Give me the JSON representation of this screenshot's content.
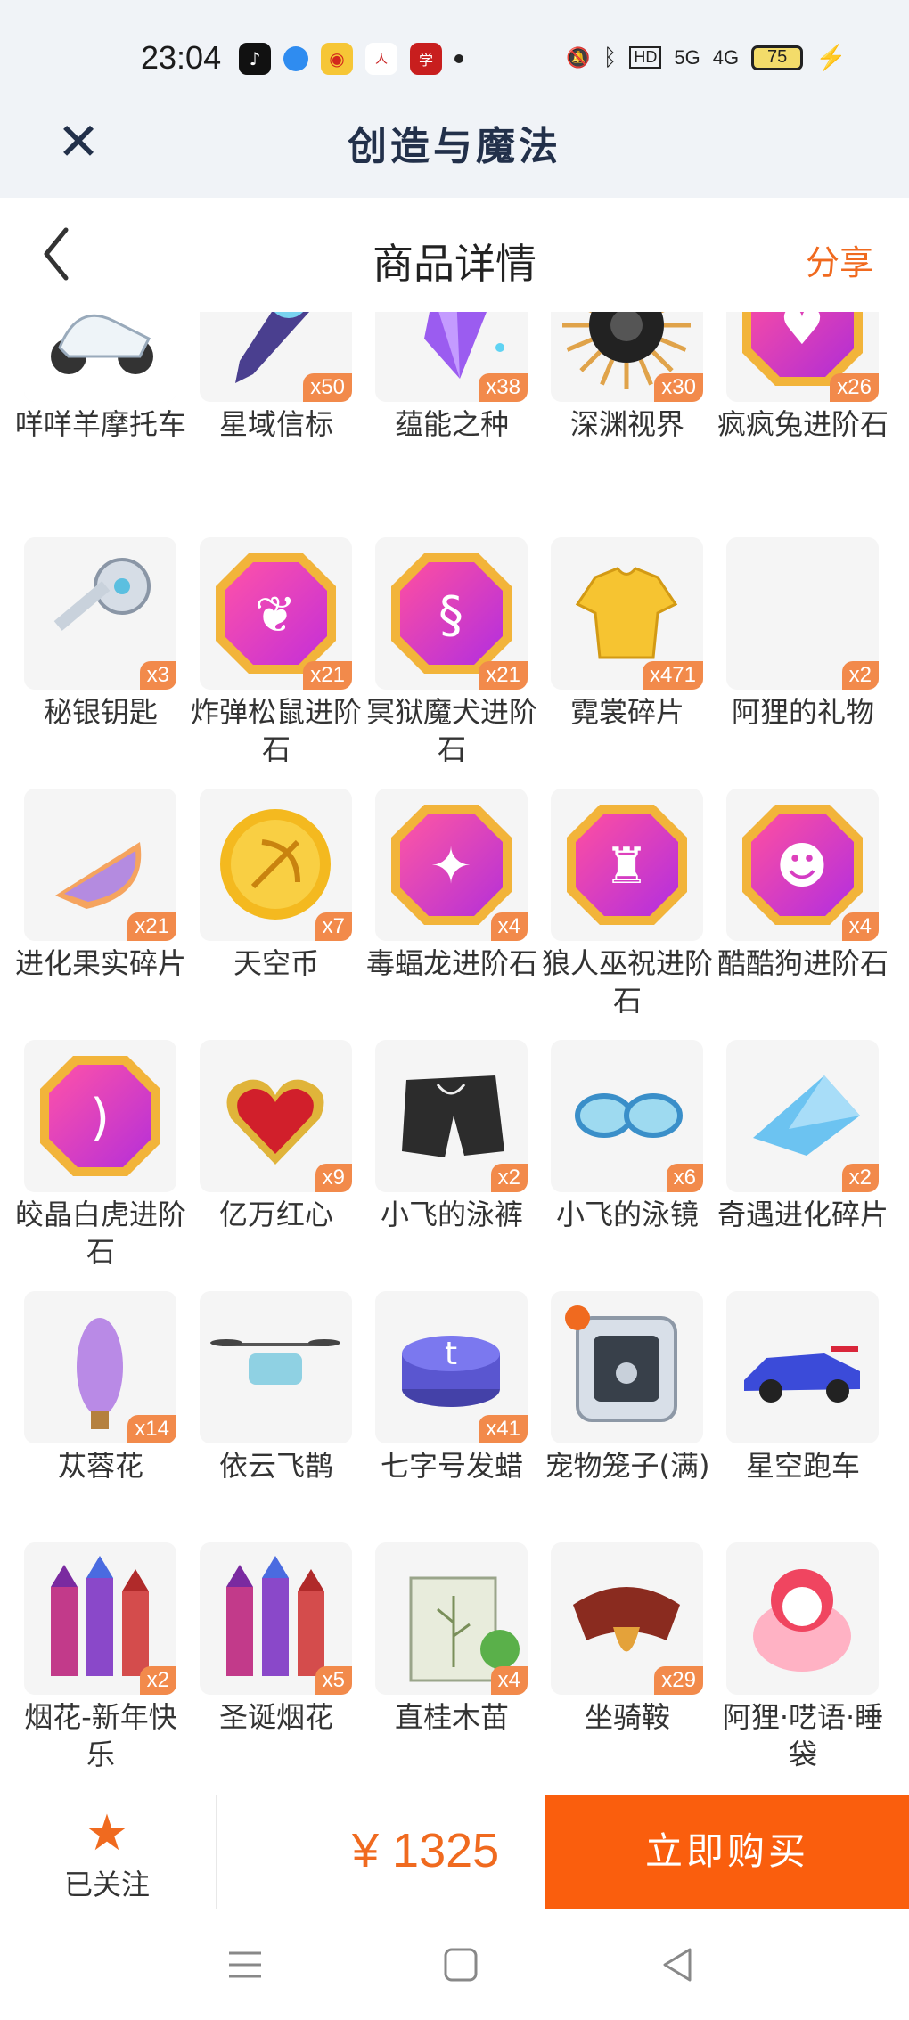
{
  "status_bar": {
    "time": "23:04",
    "apps": [
      "tiktok-icon",
      "blue-app-icon",
      "weibo-icon",
      "people-daily-icon",
      "study-app-icon"
    ],
    "hd": "HD",
    "net1": "5G",
    "net2": "4G",
    "battery": "75"
  },
  "app": {
    "title": "创造与魔法",
    "close_icon": "close-icon"
  },
  "page": {
    "title": "商品详情",
    "share": "分享",
    "back_icon": "chevron-left-icon"
  },
  "items": [
    {
      "name": "咩咩羊摩托车",
      "qty": "",
      "icon": "scooter-icon"
    },
    {
      "name": "星域信标",
      "qty": "x50",
      "icon": "star-beacon-icon"
    },
    {
      "name": "蕴能之种",
      "qty": "x38",
      "icon": "purple-crystal-icon"
    },
    {
      "name": "深渊视界",
      "qty": "x30",
      "icon": "abyss-sun-icon"
    },
    {
      "name": "疯疯兔进阶石",
      "qty": "x26",
      "icon": "rabbit-gem-icon"
    },
    {
      "name": "秘银钥匙",
      "qty": "x3",
      "icon": "mithril-key-icon"
    },
    {
      "name": "炸弹松鼠进阶石",
      "qty": "x21",
      "icon": "squirrel-gem-icon"
    },
    {
      "name": "冥狱魔犬进阶石",
      "qty": "x21",
      "icon": "hound-gem-icon"
    },
    {
      "name": "霓裳碎片",
      "qty": "x471",
      "icon": "shirt-icon"
    },
    {
      "name": "阿狸的礼物",
      "qty": "x2",
      "icon": "gift-icon"
    },
    {
      "name": "进化果实碎片",
      "qty": "x21",
      "icon": "fruit-slice-icon"
    },
    {
      "name": "天空币",
      "qty": "x7",
      "icon": "sky-coin-icon"
    },
    {
      "name": "毒蝠龙进阶石",
      "qty": "x4",
      "icon": "bat-dragon-gem-icon"
    },
    {
      "name": "狼人巫祝进阶石",
      "qty": "",
      "icon": "werewolf-gem-icon"
    },
    {
      "name": "酷酷狗进阶石",
      "qty": "x4",
      "icon": "cool-dog-gem-icon"
    },
    {
      "name": "皎晶白虎进阶石",
      "qty": "",
      "icon": "white-tiger-gem-icon"
    },
    {
      "name": "亿万红心",
      "qty": "x9",
      "icon": "red-heart-icon"
    },
    {
      "name": "小飞的泳裤",
      "qty": "x2",
      "icon": "swim-trunks-icon"
    },
    {
      "name": "小飞的泳镜",
      "qty": "x6",
      "icon": "swim-goggles-icon"
    },
    {
      "name": "奇遇进化碎片",
      "qty": "x2",
      "icon": "blue-shard-icon"
    },
    {
      "name": "苁蓉花",
      "qty": "x14",
      "icon": "flower-icon"
    },
    {
      "name": "依云飞鹊",
      "qty": "",
      "icon": "drone-icon"
    },
    {
      "name": "七字号发蜡",
      "qty": "x41",
      "icon": "hair-wax-icon"
    },
    {
      "name": "宠物笼子(满)",
      "qty": "",
      "icon": "pet-cage-icon"
    },
    {
      "name": "星空跑车",
      "qty": "",
      "icon": "race-car-icon"
    },
    {
      "name": "烟花-新年快乐",
      "qty": "x2",
      "icon": "fireworks-icon"
    },
    {
      "name": "圣诞烟花",
      "qty": "x5",
      "icon": "fireworks-icon"
    },
    {
      "name": "直桂木苗",
      "qty": "x4",
      "icon": "seed-packet-icon"
    },
    {
      "name": "坐骑鞍",
      "qty": "x29",
      "icon": "saddle-icon"
    },
    {
      "name": "阿狸·呓语·睡袋",
      "qty": "",
      "icon": "fox-sleeping-bag-icon"
    }
  ],
  "bottom": {
    "follow_label": "已关注",
    "star_icon": "star-icon",
    "price": "¥ 1325",
    "buy_label": "立即购买"
  },
  "colors": {
    "accent": "#f06a1f",
    "buy": "#fa5e0d",
    "qty_badge": "#f28a4b"
  }
}
